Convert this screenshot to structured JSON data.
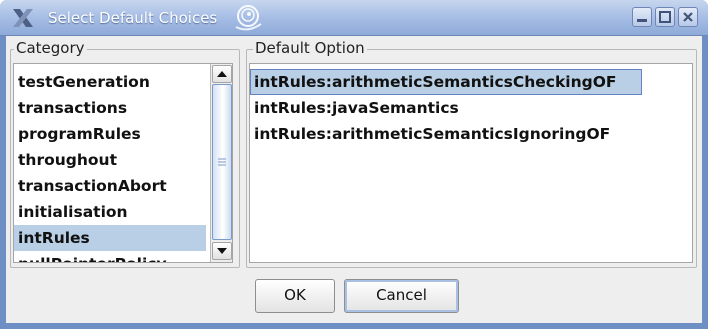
{
  "window": {
    "title": "Select Default Choices"
  },
  "category": {
    "label": "Category",
    "items": [
      "testGeneration",
      "transactions",
      "programRules",
      "throughout",
      "transactionAbort",
      "initialisation",
      "intRules",
      "nullPointerPolicy"
    ],
    "selected": "intRules"
  },
  "default_option": {
    "label": "Default Option",
    "items": [
      "intRules:arithmeticSemanticsCheckingOF",
      "intRules:javaSemantics",
      "intRules:arithmeticSemanticsIgnoringOF"
    ],
    "selected": "intRules:arithmeticSemanticsCheckingOF"
  },
  "buttons": {
    "ok": "OK",
    "cancel": "Cancel"
  },
  "icons": {
    "app": "x-logo-icon",
    "swirl": "gnome-swirl-icon",
    "minimize": "minimize-icon",
    "maximize": "maximize-icon",
    "close": "close-icon",
    "scroll_up": "arrow-up-icon",
    "scroll_down": "arrow-down-icon",
    "grip": "scroll-grip-icon"
  },
  "colors": {
    "title_bar": "#a9c0e6",
    "selection": "#b8cfe5",
    "selection_border": "#6382bf"
  }
}
